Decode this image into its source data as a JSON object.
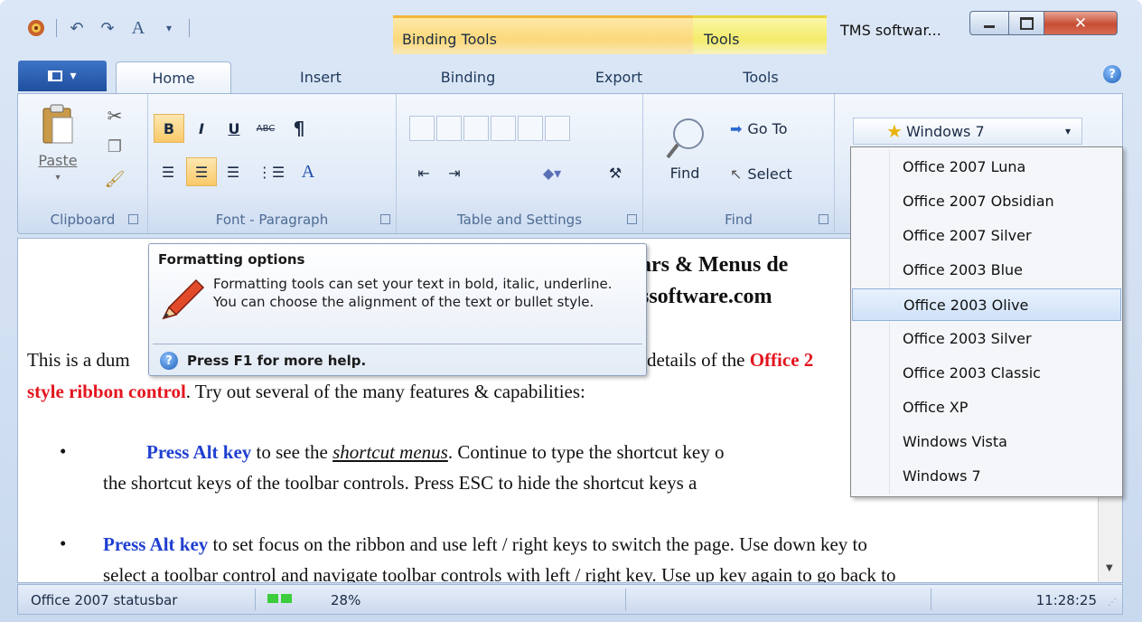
{
  "window": {
    "title": "TMS softwar...",
    "context_binding_label": "Binding Tools",
    "context_tools_label": "Tools"
  },
  "tabs": [
    {
      "label": "Home"
    },
    {
      "label": "Insert"
    },
    {
      "label": "Binding"
    },
    {
      "label": "Export"
    },
    {
      "label": "Tools"
    }
  ],
  "groups": {
    "clipboard": {
      "label": "Clipboard",
      "paste": "Paste"
    },
    "font": {
      "label": "Font - Paragraph",
      "bold": "B",
      "italic": "I",
      "underline": "U",
      "strike": "ABC",
      "para": "¶",
      "fontA": "A"
    },
    "table": {
      "label": "Table and Settings"
    },
    "find": {
      "label": "Find",
      "find": "Find",
      "goto": "Go To",
      "select": "Select"
    },
    "theme": {
      "selected": "Windows 7"
    }
  },
  "theme_menu": {
    "items": [
      {
        "label": "Office 2007 Luna",
        "highlighted": false
      },
      {
        "label": "Office 2007 Obsidian",
        "highlighted": false
      },
      {
        "label": "Office 2007 Silver",
        "highlighted": false
      },
      {
        "label": "Office 2003 Blue",
        "highlighted": false
      },
      {
        "label": "Office 2003 Olive",
        "highlighted": true
      },
      {
        "label": "Office 2003 Silver",
        "highlighted": false
      },
      {
        "label": "Office 2003 Classic",
        "highlighted": false
      },
      {
        "label": "Office XP",
        "highlighted": false
      },
      {
        "label": "Windows Vista",
        "highlighted": false
      },
      {
        "label": "Windows 7",
        "highlighted": false
      }
    ]
  },
  "tooltip": {
    "title": "Formatting options",
    "body": "Formatting tools can set your text in bold, italic, underline. You can choose the alignment of the text or bullet style.",
    "help": "Press F1 for more help."
  },
  "document": {
    "title_frag1": "ars & Menus de",
    "title_frag2": "ssoftware.com",
    "p1_a": "This is a dum",
    "p1_b": "details of the ",
    "p1_red1": "Office 2",
    "p1_red2": "style ribbon control",
    "p1_c": ".  Try out several of the many features & capabilities:",
    "b1_key": "Press Alt key",
    "b1_a": " to see the ",
    "b1_link": "shortcut menus",
    "b1_b": ". Continue to type the shortcut key o",
    "b1_line2": "the shortcut keys of the toolbar controls. Press ESC to hide the shortcut keys a",
    "b2_key": "Press Alt key",
    "b2_a": " to set focus on the ribbon and use left / right keys to switch the page. Use down key to",
    "b2_line2": "select a toolbar control and navigate toolbar controls with left / right key. Use up key again to go back to"
  },
  "statusbar": {
    "text": "Office 2007 statusbar",
    "progress": 0.28,
    "progress_label": "28%",
    "time": "11:28:25"
  },
  "colors": {
    "accent_red": "#e4151f",
    "link_blue": "#1f3fd1",
    "highlight": "#cfe2f8"
  }
}
